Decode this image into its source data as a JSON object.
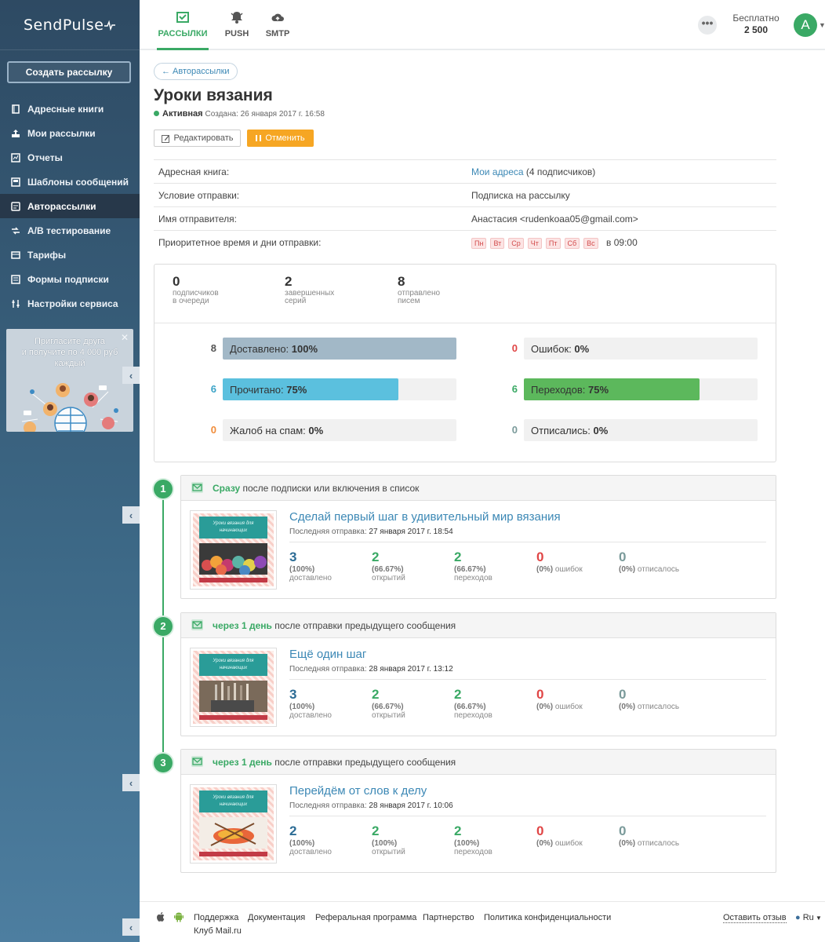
{
  "app": {
    "logo": "SendPulse"
  },
  "sidebar": {
    "create_button": "Создать рассылку",
    "items": [
      {
        "label": "Адресные книги",
        "icon": "book-icon"
      },
      {
        "label": "Мои рассылки",
        "icon": "send-icon"
      },
      {
        "label": "Отчеты",
        "icon": "report-icon"
      },
      {
        "label": "Шаблоны сообщений",
        "icon": "template-icon"
      },
      {
        "label": "Авторассылки",
        "icon": "autoresponder-icon",
        "active": true
      },
      {
        "label": "A/B тестирование",
        "icon": "ab-test-icon"
      },
      {
        "label": "Тарифы",
        "icon": "pricing-icon"
      },
      {
        "label": "Формы подписки",
        "icon": "form-icon"
      },
      {
        "label": "Настройки сервиса",
        "icon": "settings-icon"
      }
    ],
    "promo": {
      "line1": "Пригласите друга",
      "line2": "и получите по 4 000 руб",
      "line3": "каждый"
    }
  },
  "header": {
    "tabs": [
      {
        "label": "РАССЫЛКИ",
        "icon": "mail-icon",
        "active": true
      },
      {
        "label": "PUSH",
        "icon": "bell-icon"
      },
      {
        "label": "SMTP",
        "icon": "cloud-icon"
      }
    ],
    "more": "•••",
    "plan_name": "Бесплатно",
    "plan_value": "2 500",
    "avatar_letter": "A"
  },
  "page": {
    "back_link": "← Авторассылки",
    "title": "Уроки вязания",
    "status": "Активная",
    "created": "Создана: 26 января 2017 г. 16:58",
    "edit_button": "Редактировать",
    "cancel_button": "Отменить"
  },
  "info": {
    "address_book_label": "Адресная книга:",
    "address_book_link": "Мои адреса",
    "address_book_count": "(4 подписчиков)",
    "condition_label": "Условие отправки:",
    "condition_value": "Подписка на рассылку",
    "sender_label": "Имя отправителя:",
    "sender_value": "Анастасия <rudenkoaa05@gmail.com>",
    "priority_label": "Приоритетное время и дни отправки:",
    "days": [
      "Пн",
      "Вт",
      "Ср",
      "Чт",
      "Пт",
      "Сб",
      "Вс"
    ],
    "time": "в 09:00"
  },
  "stats": {
    "summary": [
      {
        "value": "0",
        "line1": "подписчиков",
        "line2": "в очереди"
      },
      {
        "value": "2",
        "line1": "завершенных",
        "line2": "серий"
      },
      {
        "value": "8",
        "line1": "отправлено",
        "line2": "писем"
      }
    ],
    "bars": [
      {
        "count": "8",
        "label": "Доставлено:",
        "pct": "100%",
        "fraction": 1.0,
        "color": "#a2b8c7",
        "num_color": "#555555"
      },
      {
        "count": "0",
        "label": "Ошибок:",
        "pct": "0%",
        "fraction": 0.0,
        "color": "#e04545",
        "num_color": "#e04545"
      },
      {
        "count": "6",
        "label": "Прочитано:",
        "pct": "75%",
        "fraction": 0.75,
        "color": "#5bc0de",
        "num_color": "#3ba3c7"
      },
      {
        "count": "6",
        "label": "Переходов:",
        "pct": "75%",
        "fraction": 0.75,
        "color": "#5cb85c",
        "num_color": "#3aa965"
      },
      {
        "count": "0",
        "label": "Жалоб на спам:",
        "pct": "0%",
        "fraction": 0.0,
        "color": "#f0a04b",
        "num_color": "#f08c3a"
      },
      {
        "count": "0",
        "label": "Отписались:",
        "pct": "0%",
        "fraction": 0.0,
        "color": "#8fa9a9",
        "num_color": "#7a9a9a"
      }
    ]
  },
  "messages": [
    {
      "step": "1",
      "when": "Сразу",
      "condition": "после подписки или включения в список",
      "title": "Сделай первый шаг в удивительный мир вязания",
      "last_label": "Последняя отправка:",
      "last_date": "27 января 2017 г. 18:54",
      "thumb_text": "Уроки вязания для начинающих",
      "stats": [
        {
          "value": "3",
          "pct": "(100%)",
          "label": "доставлено"
        },
        {
          "value": "2",
          "pct": "(66.67%)",
          "label": "открытий"
        },
        {
          "value": "2",
          "pct": "(66.67%)",
          "label": "переходов"
        },
        {
          "value": "0",
          "pct": "(0%)",
          "label": "ошибок"
        },
        {
          "value": "0",
          "pct": "(0%)",
          "label": "отписалось"
        }
      ]
    },
    {
      "step": "2",
      "when": "через 1 день",
      "condition": "после отправки предыдущего сообщения",
      "title": "Ещё один шаг",
      "last_label": "Последняя отправка:",
      "last_date": "28 января 2017 г. 13:12",
      "thumb_text": "Уроки вязания для начинающих",
      "stats": [
        {
          "value": "3",
          "pct": "(100%)",
          "label": "доставлено"
        },
        {
          "value": "2",
          "pct": "(66.67%)",
          "label": "открытий"
        },
        {
          "value": "2",
          "pct": "(66.67%)",
          "label": "переходов"
        },
        {
          "value": "0",
          "pct": "(0%)",
          "label": "ошибок"
        },
        {
          "value": "0",
          "pct": "(0%)",
          "label": "отписалось"
        }
      ]
    },
    {
      "step": "3",
      "when": "через 1 день",
      "condition": "после отправки предыдущего сообщения",
      "title": "Перейдём от слов к делу",
      "last_label": "Последняя отправка:",
      "last_date": "28 января 2017 г. 10:06",
      "thumb_text": "Уроки вязания для начинающих",
      "stats": [
        {
          "value": "2",
          "pct": "(100%)",
          "label": "доставлено"
        },
        {
          "value": "2",
          "pct": "(100%)",
          "label": "открытий"
        },
        {
          "value": "2",
          "pct": "(100%)",
          "label": "переходов"
        },
        {
          "value": "0",
          "pct": "(0%)",
          "label": "ошибок"
        },
        {
          "value": "0",
          "pct": "(0%)",
          "label": "отписалось"
        }
      ]
    }
  ],
  "footer": {
    "links": [
      "Поддержка",
      "Документация",
      "Реферальная программа",
      "Партнерство",
      "Политика конфиденциальности"
    ],
    "club": "Клуб Mail.ru",
    "feedback": "Оставить отзыв",
    "language": "Ru"
  }
}
